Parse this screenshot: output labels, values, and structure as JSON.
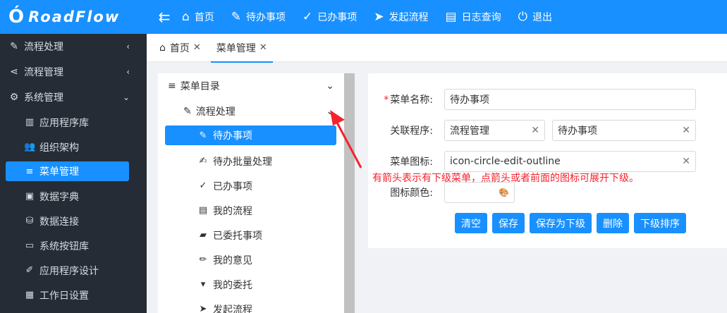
{
  "brand": {
    "logo": "Ó",
    "name": "RoadFlow"
  },
  "topnav": [
    {
      "icon": "home-icon",
      "glyph": "⌂",
      "label": "首页"
    },
    {
      "icon": "todo-icon",
      "glyph": "✎",
      "label": "待办事项"
    },
    {
      "icon": "done-icon",
      "glyph": "✓",
      "label": "已办事项"
    },
    {
      "icon": "send-icon",
      "glyph": "➤",
      "label": "发起流程"
    },
    {
      "icon": "log-icon",
      "glyph": "▤",
      "label": "日志查询"
    },
    {
      "icon": "exit-icon",
      "glyph": "⏻",
      "label": "退出"
    }
  ],
  "sidebar": {
    "groups": [
      {
        "icon": "edit-circle-icon",
        "glyph": "✎",
        "label": "流程处理",
        "chevron": "‹"
      },
      {
        "icon": "share-icon",
        "glyph": "⋖",
        "label": "流程管理",
        "chevron": "‹"
      },
      {
        "icon": "gear-icon",
        "glyph": "⚙",
        "label": "系统管理",
        "chevron": "⌄"
      }
    ],
    "items": [
      {
        "icon": "app-library-icon",
        "glyph": "▥",
        "label": "应用程序库",
        "active": false
      },
      {
        "icon": "org-icon",
        "glyph": "👥",
        "label": "组织架构",
        "active": false
      },
      {
        "icon": "menu-icon",
        "glyph": "≡",
        "label": "菜单管理",
        "active": true
      },
      {
        "icon": "dictionary-icon",
        "glyph": "▣",
        "label": "数据字典",
        "active": false
      },
      {
        "icon": "database-icon",
        "glyph": "⛁",
        "label": "数据连接",
        "active": false
      },
      {
        "icon": "button-library-icon",
        "glyph": "▭",
        "label": "系统按钮库",
        "active": false
      },
      {
        "icon": "app-design-icon",
        "glyph": "✐",
        "label": "应用程序设计",
        "active": false
      },
      {
        "icon": "calendar-icon",
        "glyph": "▦",
        "label": "工作日设置",
        "active": false
      }
    ]
  },
  "tabs": [
    {
      "icon": "home-icon",
      "glyph": "⌂",
      "label": "首页",
      "close": "✕",
      "active": false
    },
    {
      "icon": "",
      "glyph": "",
      "label": "菜单管理",
      "close": "✕",
      "active": true
    }
  ],
  "tree": {
    "root": {
      "icon": "menu-icon",
      "glyph": "≡",
      "label": "菜单目录",
      "chevron": "⌄"
    },
    "child": {
      "icon": "edit-circle-icon",
      "glyph": "✎",
      "label": "流程处理",
      "chevron": "⌄"
    },
    "leaves": [
      {
        "icon": "edit-circle-icon",
        "glyph": "✎",
        "label": "待办事项",
        "active": true
      },
      {
        "icon": "file-edit-icon",
        "glyph": "✍",
        "label": "待办批量处理",
        "active": false
      },
      {
        "icon": "check-circle-icon",
        "glyph": "✓",
        "label": "已办事项",
        "active": false
      },
      {
        "icon": "file-icon",
        "glyph": "▤",
        "label": "我的流程",
        "active": false
      },
      {
        "icon": "folder-icon",
        "glyph": "▰",
        "label": "已委托事项",
        "active": false
      },
      {
        "icon": "pencil-icon",
        "glyph": "✏",
        "label": "我的意见",
        "active": false
      },
      {
        "icon": "folder-download-icon",
        "glyph": "▾",
        "label": "我的委托",
        "active": false
      },
      {
        "icon": "send-icon",
        "glyph": "➤",
        "label": "发起流程",
        "active": false
      }
    ]
  },
  "form": {
    "name_label": "菜单名称:",
    "name_required": "*",
    "name_value": "待办事项",
    "program_label": "关联程序:",
    "program_value1": "流程管理",
    "program_value2": "待办事项",
    "icon_label": "菜单图标:",
    "icon_value": "icon-circle-edit-outline",
    "color_label": "图标颜色:",
    "color_value": "",
    "clear_glyph": "✕",
    "palette_glyph": "🎨"
  },
  "buttons": [
    "清空",
    "保存",
    "保存为下级",
    "删除",
    "下级排序"
  ],
  "annotation": "有箭头表示有下级菜单，点箭头或者前面的图标可展开下级。",
  "colors": {
    "primary": "#1890ff",
    "sidebar": "#252c35",
    "annotation": "#f5222d"
  }
}
